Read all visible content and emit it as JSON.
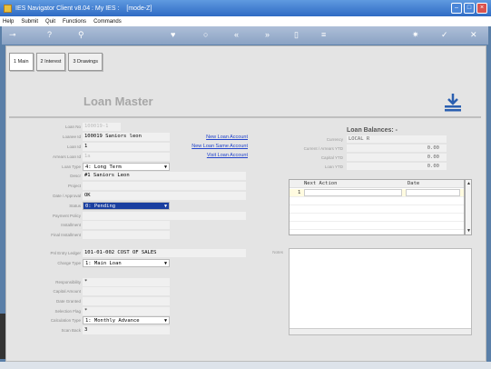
{
  "window": {
    "title": "IES Navigator Client v8.04 : My IES :",
    "mode": "[mode-Z]"
  },
  "menu": [
    "Help",
    "Submit",
    "Quit",
    "Functions",
    "Commands"
  ],
  "tabs": [
    {
      "label": "1 Main"
    },
    {
      "label": "2 Interest"
    },
    {
      "label": "3 Drawings"
    }
  ],
  "heading": "Loan Master",
  "form": {
    "loan_no": {
      "label": "Loan No",
      "value": "100019-1"
    },
    "loanee_id": {
      "label": "Loanee Id",
      "value": "100019 Saniors leon"
    },
    "loan_id": {
      "label": "Loan Id",
      "value": "1"
    },
    "arrears_loan_id": {
      "label": "Arrears Loan Id",
      "value": "1a"
    },
    "loan_type": {
      "label": "Loan Type",
      "value": "4: Long Term"
    },
    "descr": {
      "label": "Descr",
      "value": "#1 Saniors Leon"
    },
    "project": {
      "label": "Project",
      "value": ""
    },
    "date_approved": {
      "label": "Date / Approval",
      "value": "OK"
    },
    "status": {
      "label": "Status",
      "value": "0: Pending"
    },
    "payment_policy": {
      "label": "Payment Policy",
      "value": ""
    },
    "installment": {
      "label": "Installment",
      "value": ""
    },
    "final_installment": {
      "label": "Final Installment",
      "value": ""
    },
    "pnl_ledger": {
      "label": "Pnl Entry Ledger",
      "value": "101-01-002 COST OF SALES"
    },
    "charge_type": {
      "label": "Charge Type",
      "value": "1: Main Loan"
    },
    "responsibility": {
      "label": "Responsibility",
      "value": "*"
    },
    "capital_amount": {
      "label": "Capital Amount",
      "value": ""
    },
    "date_granted": {
      "label": "Date Granted",
      "value": ""
    },
    "selection_flag": {
      "label": "Selection Flag",
      "value": "*"
    },
    "calculation_type": {
      "label": "Calculation Type",
      "value": "1: Monthly Advance"
    },
    "scan_back": {
      "label": "Scan Back",
      "value": "3"
    }
  },
  "links": {
    "new_loan_account": "New Loan Account",
    "new_loan_same_account": "New Loan Same Account",
    "visit_loan_account": "Visit Loan Account"
  },
  "balances": {
    "title": "Loan Balances: -",
    "currency": {
      "label": "Currency",
      "value": "LOCAL R"
    },
    "current_arrears_ytd": {
      "label": "Current / Arrears YTD",
      "value": "0.00"
    },
    "capital_ytd": {
      "label": "Capital YTD",
      "value": "0.00"
    },
    "loan_ytd": {
      "label": "Loan YTD",
      "value": "0.00"
    }
  },
  "action_grid": {
    "columns": [
      "Next Action",
      "Date"
    ],
    "rows": [
      {
        "num": "1",
        "action": "",
        "date": ""
      }
    ]
  },
  "notes": {
    "label": "Notes"
  }
}
